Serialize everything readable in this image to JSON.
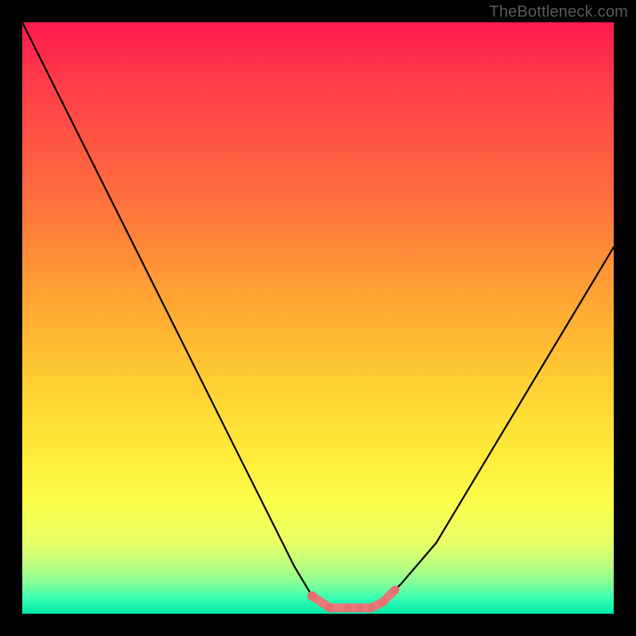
{
  "watermark": "TheBottleneck.com",
  "colors": {
    "frame": "#000000",
    "curve": "#000000",
    "accent_dots": "#e77a7a",
    "accent_dots_fill": "#e86f6f"
  },
  "chart_data": {
    "type": "line",
    "title": "",
    "xlabel": "",
    "ylabel": "",
    "xlim": [
      0,
      100
    ],
    "ylim": [
      0,
      100
    ],
    "grid": false,
    "legend": false,
    "annotations": [
      "TheBottleneck.com"
    ],
    "series": [
      {
        "name": "bottleneck-curve",
        "x": [
          0,
          6,
          12,
          18,
          24,
          30,
          36,
          42,
          46,
          49,
          52,
          55,
          58,
          61,
          64,
          70,
          76,
          82,
          88,
          94,
          100
        ],
        "values": [
          100,
          88,
          76,
          64,
          52,
          40,
          28,
          16,
          8,
          3,
          1,
          1,
          1,
          2,
          5,
          12,
          22,
          32,
          42,
          52,
          62
        ]
      },
      {
        "name": "accent-dots",
        "x": [
          49,
          52,
          55,
          57,
          59,
          61,
          63
        ],
        "values": [
          3,
          1,
          1,
          1,
          1,
          2,
          4
        ]
      }
    ]
  }
}
